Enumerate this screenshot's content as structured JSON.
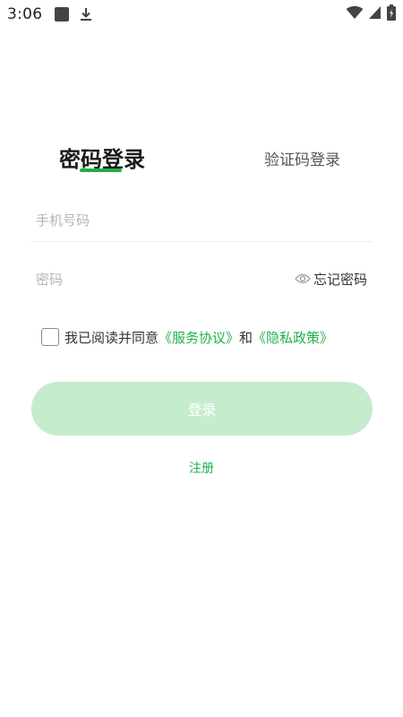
{
  "status_bar": {
    "time": "3:06",
    "icons": [
      "app-square-icon",
      "download-icon",
      "wifi-icon",
      "signal-icon",
      "battery-icon"
    ]
  },
  "tabs": {
    "password_login": "密码登录",
    "code_login": "验证码登录",
    "active": "password_login"
  },
  "form": {
    "phone_placeholder": "手机号码",
    "phone_value": "",
    "password_placeholder": "密码",
    "password_value": "",
    "forgot_label": "忘记密码"
  },
  "agreement": {
    "checked": false,
    "prefix": "我已阅读并同意",
    "service_link": "《服务协议》",
    "and": "和",
    "privacy_link": "《隐私政策》"
  },
  "actions": {
    "login_label": "登录",
    "register_label": "注册"
  },
  "colors": {
    "accent": "#1fb04a",
    "button_disabled": "#c6ecce",
    "placeholder": "#b4b4b4"
  }
}
